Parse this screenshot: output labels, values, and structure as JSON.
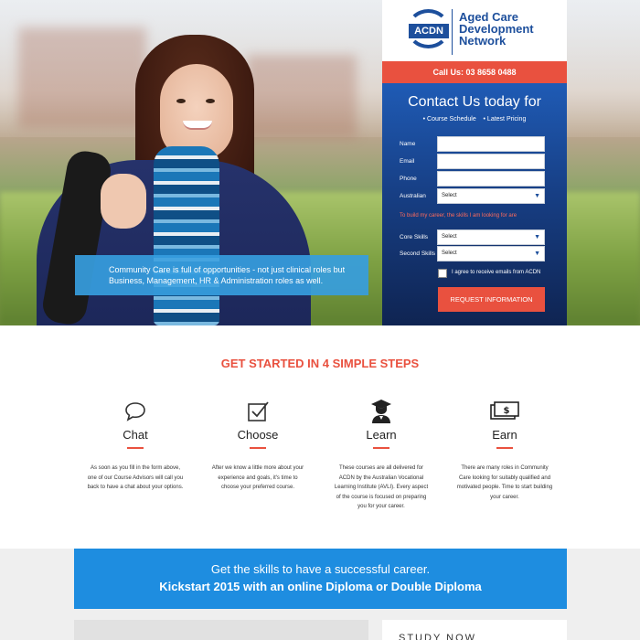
{
  "brand": {
    "logo_abbr": "ACDN",
    "name_line1": "Aged Care",
    "name_line2": "Development",
    "name_line3": "Network"
  },
  "hero": {
    "caption": "Community Care is full of opportunities - not just clinical roles but Business, Management, HR & Administration roles as well."
  },
  "form": {
    "call": "Call Us: 03 8658 0488",
    "title": "Contact Us today for",
    "sub_items": [
      "• Course Schedule",
      "• Latest Pricing"
    ],
    "labels": {
      "name": "Name",
      "email": "Email",
      "phone": "Phone",
      "australian": "Australian",
      "core": "Core Skills",
      "second": "Second Skills"
    },
    "select_value": "Select",
    "note": "To build my career, the skills I am looking for are",
    "agree": "I agree to receive emails from ACDN",
    "submit": "REQUEST INFORMATION"
  },
  "steps": {
    "title": "GET STARTED IN 4 SIMPLE STEPS",
    "items": [
      {
        "name": "Chat",
        "icon": "chat-bubble-icon",
        "desc": "As soon as you fill in the form above, one of our Course Advisors will call you back to have a chat about your options."
      },
      {
        "name": "Choose",
        "icon": "checkbox-icon",
        "desc": "After we know a little more about your experience and goals, it's time to choose your preferred course."
      },
      {
        "name": "Learn",
        "icon": "graduate-icon",
        "desc": "These courses are all delivered for ACDN by the Australian Vocational Learning Institute (AVLI). Every aspect of the course is focused on preparing you for your career."
      },
      {
        "name": "Earn",
        "icon": "money-icon",
        "desc": "There are many roles in Community Care looking for suitably qualified and motivated people. Time to start building your career."
      }
    ]
  },
  "banner": {
    "line1": "Get the skills to have a successful career.",
    "line2": "Kickstart 2015 with an online Diploma or Double Diploma"
  },
  "bottom": {
    "partial_text": "STUDY NOW"
  },
  "colors": {
    "accent": "#e9513f",
    "brand_blue": "#1d4f9c",
    "banner_blue": "#1e8de0"
  }
}
